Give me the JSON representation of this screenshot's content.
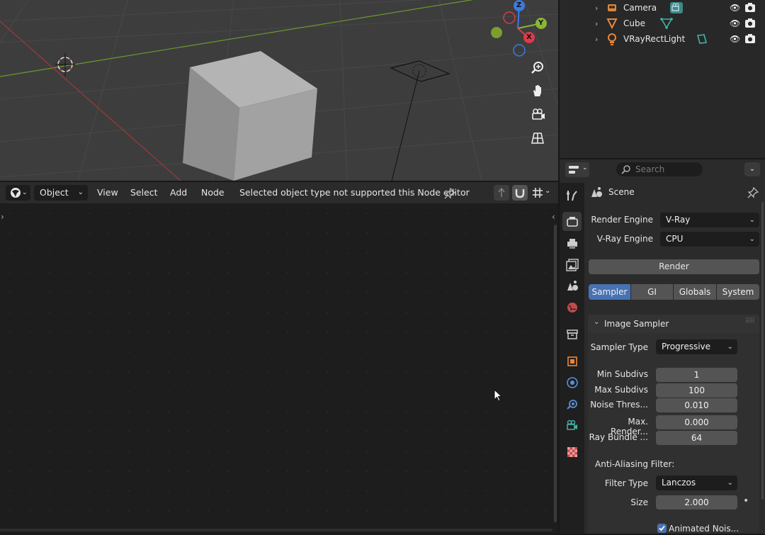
{
  "outliner": {
    "items": [
      {
        "label": "Camera",
        "icon": "camera-object-icon"
      },
      {
        "label": "Cube",
        "icon": "mesh-object-icon"
      },
      {
        "label": "VRayRectLight",
        "icon": "light-object-icon"
      }
    ]
  },
  "viewport": {
    "gizmo": {
      "z": "Z",
      "y": "Y",
      "x": "X"
    },
    "nav_icons": [
      "zoom-icon",
      "hand-pan-icon",
      "camera-view-icon",
      "grid-perspective-icon"
    ]
  },
  "node_editor": {
    "editor_type_icon": "node-editor-icon",
    "object_dropdown": "Object",
    "menus": [
      "View",
      "Select",
      "Add",
      "Node"
    ],
    "status": "Selected object type not supported this Node editor"
  },
  "properties": {
    "search_placeholder": "Search",
    "context": "Scene",
    "render_engine_label": "Render Engine",
    "render_engine_value": "V-Ray",
    "vray_engine_label": "V-Ray Engine",
    "vray_engine_value": "CPU",
    "render_button": "Render",
    "tabs": [
      "Sampler",
      "GI",
      "Globals",
      "System"
    ],
    "active_tab": "Sampler",
    "panel_title": "Image Sampler",
    "sampler_type_label": "Sampler Type",
    "sampler_type_value": "Progressive",
    "fields": [
      {
        "label": "Min Subdivs",
        "value": "1"
      },
      {
        "label": "Max Subdivs",
        "value": "100"
      },
      {
        "label": "Noise Thres...",
        "value": "0.010"
      },
      {
        "label": "Max. Render...",
        "value": "0.000"
      },
      {
        "label": "Ray Bundle ...",
        "value": "64"
      }
    ],
    "aa_heading": "Anti-Aliasing Filter:",
    "filter_type_label": "Filter Type",
    "filter_type_value": "Lanczos",
    "size_label": "Size",
    "size_value": "2.000",
    "animated_noise_label": "Animated Nois..."
  },
  "colors": {
    "accent": "#4772b3",
    "viewport_bg": "#3d3d3d",
    "panel_bg": "#2b2b2b"
  }
}
